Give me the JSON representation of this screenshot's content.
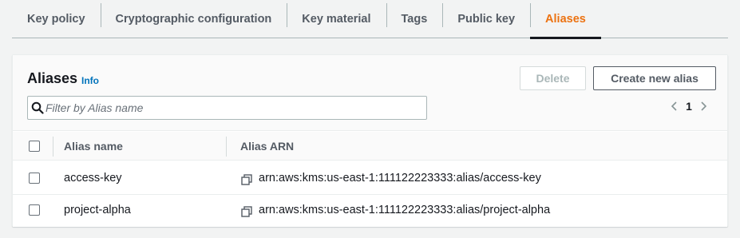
{
  "tabs": [
    {
      "label": "Key policy",
      "active": false
    },
    {
      "label": "Cryptographic configuration",
      "active": false
    },
    {
      "label": "Key material",
      "active": false
    },
    {
      "label": "Tags",
      "active": false
    },
    {
      "label": "Public key",
      "active": false
    },
    {
      "label": "Aliases",
      "active": true
    }
  ],
  "panel": {
    "title": "Aliases",
    "info_link": "Info",
    "delete_label": "Delete",
    "create_label": "Create new alias",
    "search": {
      "placeholder": "Filter by Alias name",
      "value": ""
    },
    "pagination": {
      "current_page": "1"
    }
  },
  "table": {
    "columns": [
      "Alias name",
      "Alias ARN"
    ],
    "rows": [
      {
        "name": "access-key",
        "arn": "arn:aws:kms:us-east-1:111122223333:alias/access-key",
        "selected": false
      },
      {
        "name": "project-alpha",
        "arn": "arn:aws:kms:us-east-1:111122223333:alias/project-alpha",
        "selected": false
      }
    ]
  },
  "colors": {
    "accent": "#ec7211",
    "link": "#0073bb",
    "text": "#16191f",
    "muted": "#545b64"
  },
  "icons": [
    "search-icon",
    "chevron-left-icon",
    "chevron-right-icon",
    "copy-icon"
  ]
}
